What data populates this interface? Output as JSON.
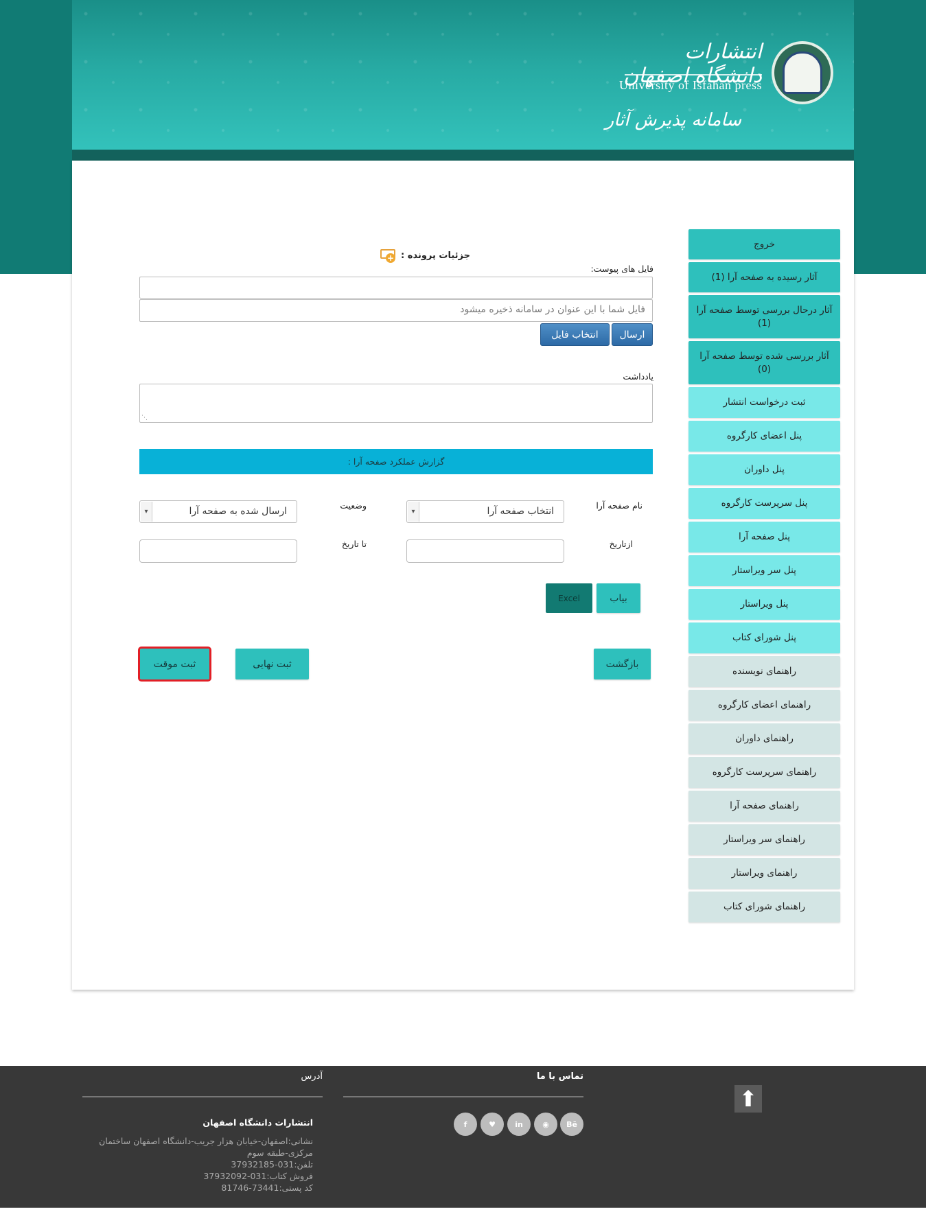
{
  "header": {
    "brand_fa": "انتشارات دانشگاه اصفهان",
    "brand_en": "University of Isfahan press",
    "system_name": "سامانه پذیرش آثار"
  },
  "sidebar": {
    "items": [
      {
        "label": "خروج"
      },
      {
        "label": "آثار رسیده به صفحه آرا (1)"
      },
      {
        "label": "آثار درحال بررسی توسط صفحه آرا (1)"
      },
      {
        "label": "آثار بررسی شده توسط صفحه آرا (0)"
      },
      {
        "label": "ثبت درخواست انتشار"
      },
      {
        "label": "پنل اعضای کارگروه"
      },
      {
        "label": "پنل داوران"
      },
      {
        "label": "پنل سرپرست کارگروه"
      },
      {
        "label": "پنل صفحه آرا"
      },
      {
        "label": "پنل سر ویراستار"
      },
      {
        "label": "پنل ویراستار"
      },
      {
        "label": "پنل شورای کتاب"
      },
      {
        "label": "راهنمای نویسنده"
      },
      {
        "label": "راهنمای اعضای کارگروه"
      },
      {
        "label": "راهنمای داوران"
      },
      {
        "label": "راهنمای سرپرست کارگروه"
      },
      {
        "label": "راهنمای صفحه آرا"
      },
      {
        "label": "راهنمای سر ویراستار"
      },
      {
        "label": "راهنمای ویراستار"
      },
      {
        "label": "راهنمای شورای کتاب"
      }
    ]
  },
  "form": {
    "details_title": "جزئیات پرونده :",
    "attachments_label": "فایل های پیوست:",
    "file_name_placeholder": "فایل شما با این عنوان در سامانه ذخیره میشود",
    "send_button": "ارسال",
    "choose_file_button": "انتخاب فایل",
    "note_label": "یادداشت",
    "report_title": "گزارش عملکرد صفحه آرا :",
    "designer_name_label": "نام صفحه آرا",
    "designer_select_value": "انتخاب صفحه آرا",
    "status_label": "وضعیت",
    "status_select_value": "ارسال شده به صفحه آرا",
    "from_date_label": "ازتاریخ",
    "to_date_label": "تا تاریخ",
    "find_button": "بیاب",
    "excel_button": "Excel",
    "back_button": "بازگشت",
    "final_submit_button": "ثبت نهایی",
    "temp_submit_button": "ثبت موقت"
  },
  "footer": {
    "contact_title": "تماس با ما",
    "address_title": "آدرس",
    "org_name": "انتشارات دانشگاه اصفهان",
    "address_lines": [
      "نشانی:اصفهان-خیابان هزار جریب-دانشگاه اصفهان ساختمان",
      "مرکزی-طبقه سوم",
      "تلفن:031-37932185",
      "فروش کتاب:031-37932092",
      "کد پستی:73441-81746"
    ],
    "social": [
      "Be",
      "rss",
      "in",
      "twitter",
      "f"
    ],
    "social_glyphs": [
      "Bē",
      "◉",
      "in",
      "♥",
      "f"
    ]
  }
}
